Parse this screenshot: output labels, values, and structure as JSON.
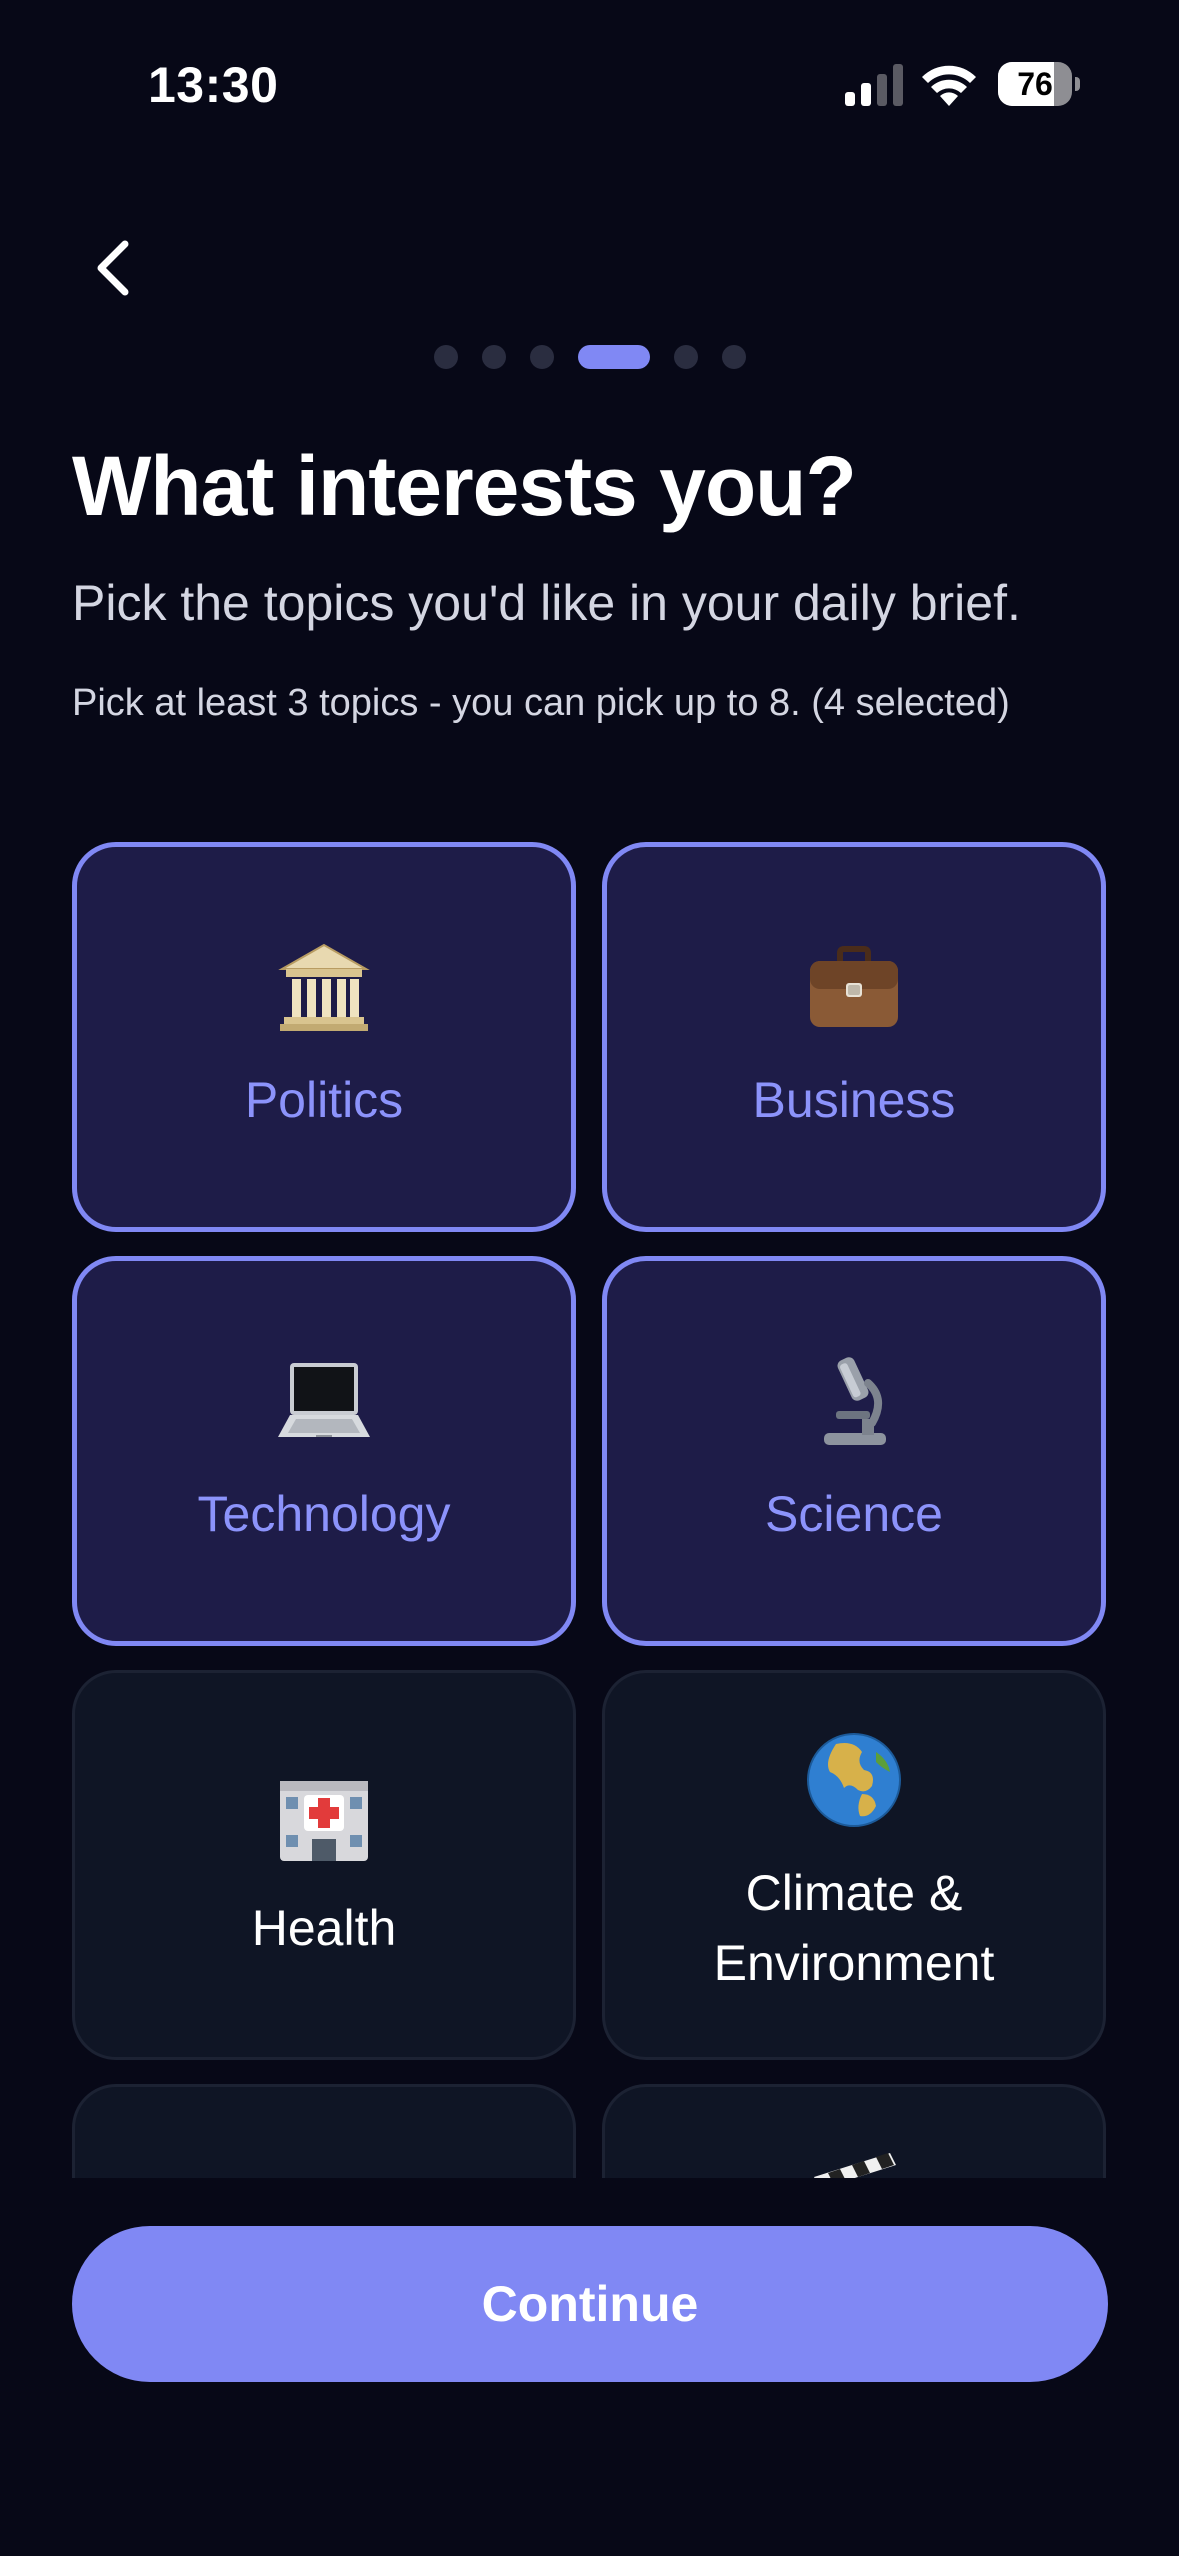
{
  "status_bar": {
    "time": "13:30",
    "battery_level": 76,
    "battery_label": "76"
  },
  "nav": {
    "back_icon": "chevron-left-icon",
    "progress": {
      "steps": 6,
      "current_step": 4
    }
  },
  "header": {
    "title": "What interests you?",
    "subtitle": "Pick the topics you'd like in your daily brief.",
    "helper": "Pick at least 3 topics - you can pick up to 8. (4 selected)"
  },
  "topics": [
    {
      "label": "Politics",
      "icon": "classical-building-icon",
      "selected": true
    },
    {
      "label": "Business",
      "icon": "briefcase-icon",
      "selected": true
    },
    {
      "label": "Technology",
      "icon": "laptop-icon",
      "selected": true
    },
    {
      "label": "Science",
      "icon": "microscope-icon",
      "selected": true
    },
    {
      "label": "Health",
      "icon": "hospital-icon",
      "selected": false
    },
    {
      "label": "Climate & Environment",
      "icon": "globe-icon",
      "selected": false
    },
    {
      "label": "",
      "icon": "",
      "selected": false
    },
    {
      "label": "",
      "icon": "clapper-board-icon",
      "selected": false
    }
  ],
  "footer": {
    "continue_label": "Continue"
  },
  "colors": {
    "background": "#070817",
    "accent": "#8088f4",
    "selected_card": "#1e1c48",
    "card": "#0f1525",
    "selected_text": "#8c93fb"
  }
}
